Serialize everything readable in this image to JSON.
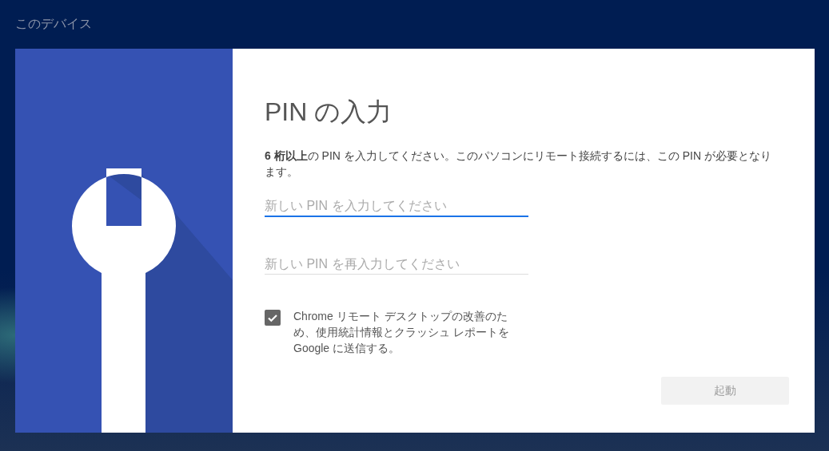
{
  "header": {
    "title": "このデバイス"
  },
  "dialog": {
    "title": "PIN の入力",
    "description": "**6 桁以上**の PIN を入力してください。このパソコンにリモート接続するには、この PIN が必要となります。",
    "fields": [
      {
        "placeholder": "新しい PIN を入力してください",
        "focused": true
      },
      {
        "placeholder": "新しい PIN を再入力してください",
        "focused": false
      }
    ],
    "consent": {
      "label": "Chrome リモート デスクトップの改善のため、使用統計情報とクラッシュ レポートを Google に送信する。",
      "checked": true
    },
    "button": {
      "label": "起動",
      "disabled": true
    }
  }
}
